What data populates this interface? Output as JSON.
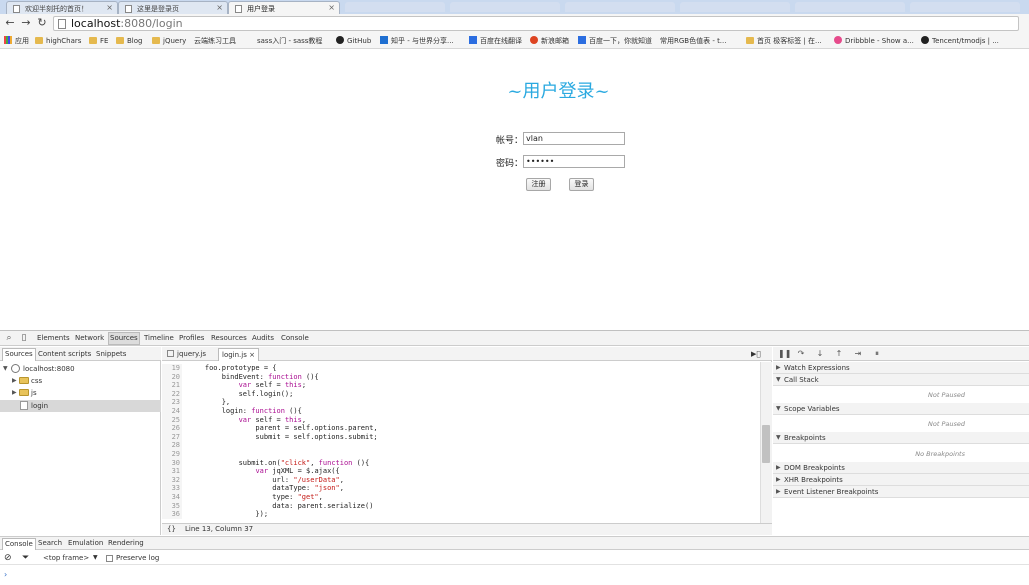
{
  "browser": {
    "tabs": [
      {
        "title": "欢迎半刻托的首页！",
        "active": false
      },
      {
        "title": "这里是登录页",
        "active": false
      },
      {
        "title": "用户登录",
        "active": true
      }
    ],
    "url_host": "localhost",
    "url_rest": ":8080/login",
    "bookmarks": [
      {
        "label": "应用",
        "icon": "apps-grid-icon"
      },
      {
        "label": "highChars",
        "icon": "folder-icon"
      },
      {
        "label": "FE",
        "icon": "folder-icon"
      },
      {
        "label": "Blog",
        "icon": "folder-icon"
      },
      {
        "label": "jQuery",
        "icon": "folder-icon"
      },
      {
        "label": "云端练习工具",
        "icon": "page-icon"
      },
      {
        "label": "sass入门 - sass教程",
        "icon": "page-icon"
      },
      {
        "label": "GitHub",
        "icon": "github-icon"
      },
      {
        "label": "知乎 - 与世界分享...",
        "icon": "zhihu-icon"
      },
      {
        "label": "百度在线翻译",
        "icon": "baidu-icon"
      },
      {
        "label": "新浪邮箱",
        "icon": "sina-icon"
      },
      {
        "label": "百度一下，你就知道",
        "icon": "baidu-icon"
      },
      {
        "label": "常用RGB色值表 - t...",
        "icon": "page-icon"
      },
      {
        "label": "首页 极客标签 | 在...",
        "icon": "folder-icon"
      },
      {
        "label": "Dribbble - Show a...",
        "icon": "dribbble-icon"
      },
      {
        "label": "Tencent/tmodjs | ...",
        "icon": "github-icon"
      }
    ]
  },
  "login": {
    "title": "~用户登录~",
    "account_label": "帐号：",
    "account_value": "vlan",
    "password_label": "密码：",
    "password_value": "••••••",
    "register_label": "注册",
    "login_label": "登录"
  },
  "devtools": {
    "main_tabs": [
      "Elements",
      "Network",
      "Sources",
      "Timeline",
      "Profiles",
      "Resources",
      "Audits",
      "Console"
    ],
    "active_main_tab": "Sources",
    "nav_tabs": [
      "Sources",
      "Content scripts",
      "Snippets"
    ],
    "tree": [
      {
        "label": "localhost:8080",
        "type": "origin"
      },
      {
        "label": "css",
        "type": "folder"
      },
      {
        "label": "js",
        "type": "folder"
      },
      {
        "label": "login",
        "type": "file"
      }
    ],
    "file_tabs": [
      "jquery.js",
      "login.js"
    ],
    "active_file": "login.js",
    "code": [
      {
        "n": "19",
        "t": "    foo.prototype = {"
      },
      {
        "n": "20",
        "t": "        bindEvent: function (){"
      },
      {
        "n": "21",
        "t": "            var self = this;"
      },
      {
        "n": "22",
        "t": "            self.login();"
      },
      {
        "n": "23",
        "t": "        },"
      },
      {
        "n": "24",
        "t": "        login: function (){"
      },
      {
        "n": "25",
        "t": "            var self = this,"
      },
      {
        "n": "26",
        "t": "                parent = self.options.parent,"
      },
      {
        "n": "27",
        "t": "                submit = self.options.submit;"
      },
      {
        "n": "28",
        "t": ""
      },
      {
        "n": "29",
        "t": ""
      },
      {
        "n": "30",
        "t": "            submit.on(\"click\", function (){"
      },
      {
        "n": "31",
        "t": "                var jqXML = $.ajax({"
      },
      {
        "n": "32",
        "t": "                    url: \"/userData\","
      },
      {
        "n": "33",
        "t": "                    dataType: \"json\","
      },
      {
        "n": "34",
        "t": "                    type: \"get\","
      },
      {
        "n": "35",
        "t": "                    data: parent.serialize()"
      },
      {
        "n": "36",
        "t": "                });"
      }
    ],
    "cursor_status": "Line 13, Column 37",
    "sections": [
      {
        "label": "Watch Expressions",
        "expanded": false,
        "body": ""
      },
      {
        "label": "Call Stack",
        "expanded": true,
        "body": "Not Paused"
      },
      {
        "label": "Scope Variables",
        "expanded": true,
        "body": "Not Paused"
      },
      {
        "label": "Breakpoints",
        "expanded": true,
        "body": "No Breakpoints"
      },
      {
        "label": "DOM Breakpoints",
        "expanded": false,
        "body": ""
      },
      {
        "label": "XHR Breakpoints",
        "expanded": false,
        "body": ""
      },
      {
        "label": "Event Listener Breakpoints",
        "expanded": false,
        "body": ""
      }
    ],
    "drawer_tabs": [
      "Console",
      "Search",
      "Emulation",
      "Rendering"
    ],
    "frame_select": "<top frame>",
    "preserve_log_label": "Preserve log",
    "prompt": "›"
  },
  "colors": {
    "title_blue": "#2aa9e0",
    "keyword": "#aa0d91",
    "string": "#c41a16"
  }
}
